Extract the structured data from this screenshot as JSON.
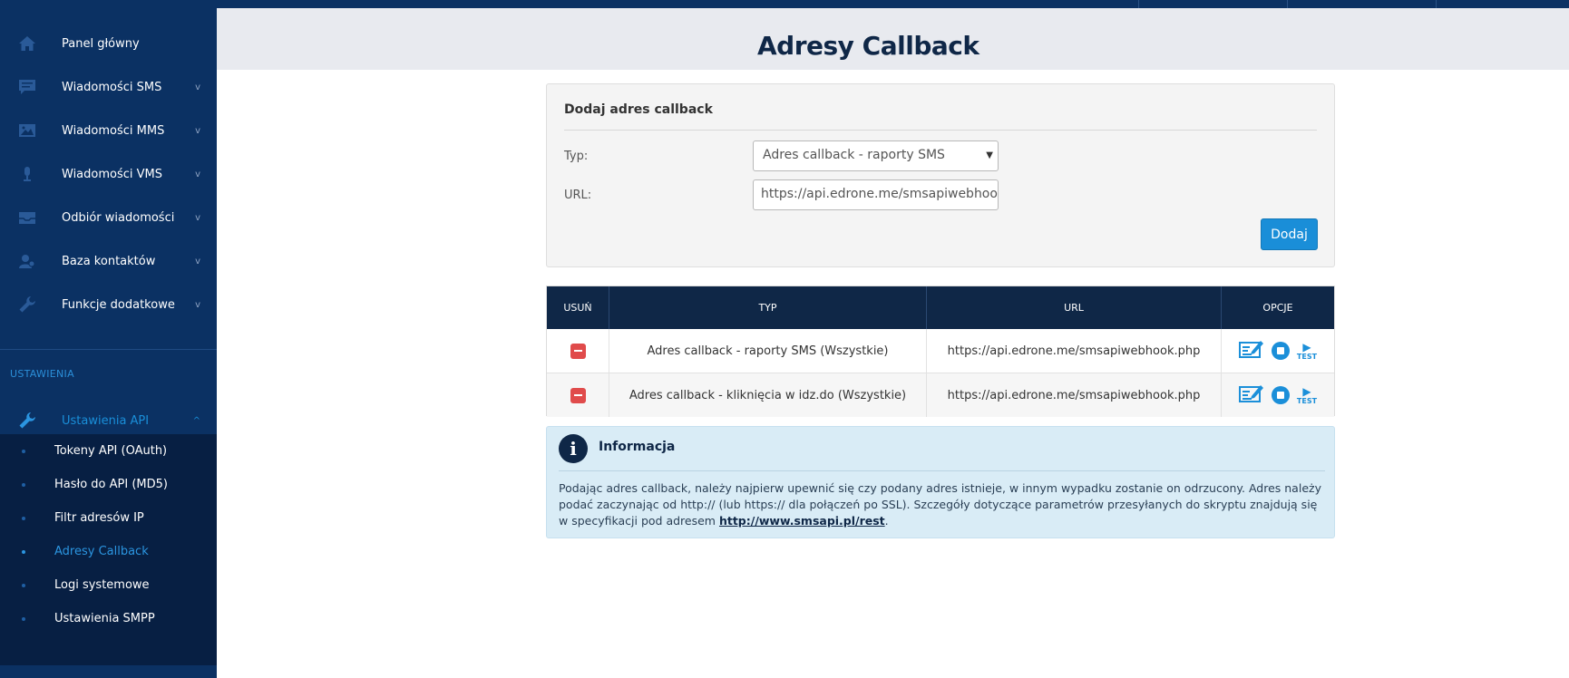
{
  "sidebar": {
    "items": [
      {
        "label": "Panel główny",
        "icon": "home-icon"
      },
      {
        "label": "Wiadomości SMS",
        "icon": "chat-icon",
        "chevron": "v"
      },
      {
        "label": "Wiadomości MMS",
        "icon": "image-icon",
        "chevron": "v"
      },
      {
        "label": "Wiadomości VMS",
        "icon": "microphone-icon",
        "chevron": "v"
      },
      {
        "label": "Odbiór wiadomości",
        "icon": "inbox-icon",
        "chevron": "v"
      },
      {
        "label": "Baza kontaktów",
        "icon": "contacts-icon",
        "chevron": "v"
      },
      {
        "label": "Funkcje dodatkowe",
        "icon": "wrench-icon",
        "chevron": "v"
      }
    ],
    "section_label": "USTAWIENIA",
    "api_settings": {
      "label": "Ustawienia API",
      "icon": "wrench-icon",
      "chevron": "^"
    },
    "subitems": [
      {
        "label": "Tokeny API (OAuth)"
      },
      {
        "label": "Hasło do API (MD5)"
      },
      {
        "label": "Filtr adresów IP"
      },
      {
        "label": "Adresy Callback",
        "active": true
      },
      {
        "label": "Logi systemowe"
      },
      {
        "label": "Ustawienia SMPP"
      }
    ]
  },
  "header": {
    "title": "Adresy Callback"
  },
  "form": {
    "title": "Dodaj adres callback",
    "type_label": "Typ:",
    "type_value": "Adres callback - raporty SMS",
    "url_label": "URL:",
    "url_value": "https://api.edrone.me/smsapiwebhook.php",
    "submit_label": "Dodaj"
  },
  "table": {
    "headers": [
      "USUŃ",
      "TYP",
      "URL",
      "OPCJE"
    ],
    "rows": [
      {
        "type": "Adres callback - raporty SMS (Wszystkie)",
        "url": "https://api.edrone.me/smsapiwebhook.php"
      },
      {
        "type": "Adres callback - kliknięcia w idz.do (Wszystkie)",
        "url": "https://api.edrone.me/smsapiwebhook.php"
      }
    ],
    "test_label": "TEST"
  },
  "info": {
    "title": "Informacja",
    "text": "Podając adres callback, należy najpierw upewnić się czy podany adres istnieje, w innym wypadku zostanie on odrzucony. Adres należy podać zaczynając od http:// (lub https:// dla połączeń po SSL). Szczegóły dotyczące parametrów przesyłanych do skryptu znajdują się w specyfikacji pod adresem ",
    "link": "http://www.smsapi.pl/rest",
    "suffix": "."
  },
  "colors": {
    "sidebar_bg": "#0b3163",
    "submenu_bg": "#071f43",
    "accent": "#1a8ed8",
    "table_header": "#0f2747",
    "delete": "#e04b4b",
    "info_bg": "#d9ecf6"
  }
}
